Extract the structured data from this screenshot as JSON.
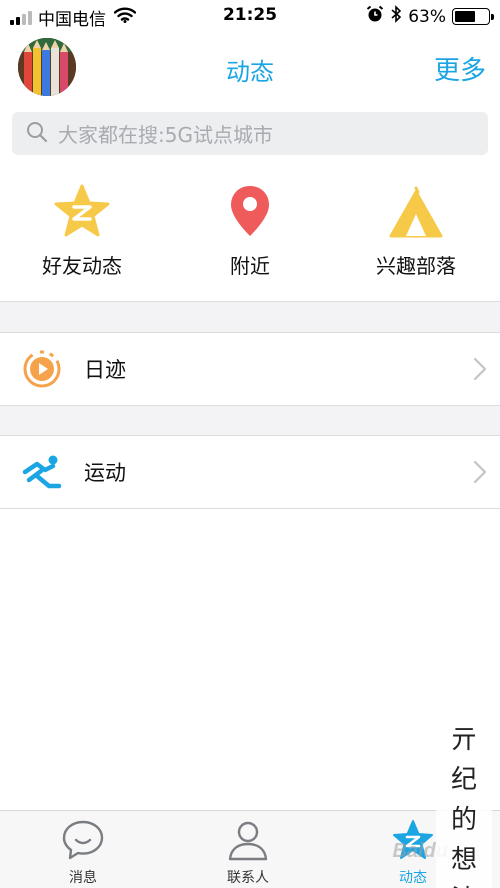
{
  "status_bar": {
    "carrier": "中国电信",
    "time": "21:25",
    "battery_text": "63%",
    "battery_level": 0.63,
    "signal_bars": 2
  },
  "header": {
    "title": "动态",
    "more": "更多"
  },
  "search": {
    "placeholder": "大家都在搜:5G试点城市"
  },
  "quick_entries": [
    {
      "label": "好友动态",
      "icon": "qzone-star-icon"
    },
    {
      "label": "附近",
      "icon": "location-pin-icon"
    },
    {
      "label": "兴趣部落",
      "icon": "tent-icon"
    }
  ],
  "list": [
    {
      "label": "日迹",
      "icon": "play-circle-icon"
    },
    {
      "label": "运动",
      "icon": "running-icon"
    }
  ],
  "tab_bar": [
    {
      "label": "消息",
      "icon": "chat-bubble-icon"
    },
    {
      "label": "联系人",
      "icon": "contacts-icon"
    },
    {
      "label": "动态",
      "icon": "star-icon",
      "active": true
    }
  ],
  "watermark": {
    "text": "亓纪的想法",
    "logo": "Baidu"
  },
  "colors": {
    "accent": "#1ca5e3",
    "star_yellow": "#f7c948",
    "pin_red": "#ef5b5b",
    "orange": "#f5a24a"
  }
}
